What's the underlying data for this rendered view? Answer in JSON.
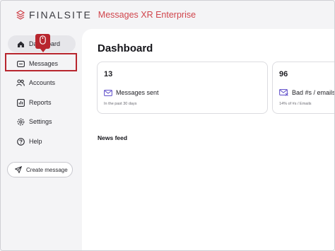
{
  "header": {
    "brand": "FINALSITE",
    "product": "Messages XR Enterprise",
    "brand_color": "#d0454c"
  },
  "sidebar": {
    "items": [
      {
        "label": "Dashboard",
        "icon": "home-icon"
      },
      {
        "label": "Messages",
        "icon": "message-icon"
      },
      {
        "label": "Accounts",
        "icon": "users-icon"
      },
      {
        "label": "Reports",
        "icon": "reports-icon"
      },
      {
        "label": "Settings",
        "icon": "gear-icon"
      },
      {
        "label": "Help",
        "icon": "help-icon"
      }
    ],
    "create_label": "Create message"
  },
  "tooltip": {
    "icon": "mouse-icon",
    "color": "#b8262e"
  },
  "main": {
    "title": "Dashboard",
    "cards": [
      {
        "value": "13",
        "label": "Messages sent",
        "sub": "In the past 30 days",
        "icon": "mail-icon"
      },
      {
        "value": "96",
        "label": "Bad #s / emails",
        "sub": "14% of #s / Emails",
        "icon": "bad-mail-icon"
      }
    ],
    "news_title": "News feed"
  }
}
